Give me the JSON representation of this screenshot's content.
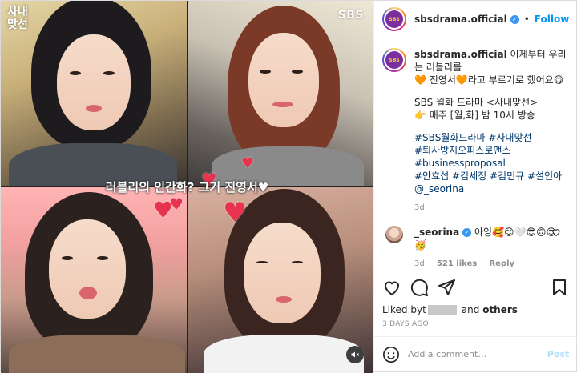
{
  "media": {
    "show_logo_line1": "사내",
    "show_logo_line2": "맞선",
    "broadcaster": "SBS",
    "overlay_caption": "러블리의 인간화? 그거 진영서♥",
    "mute_icon": "speaker-muted-icon"
  },
  "header": {
    "username": "sbsdrama.official",
    "verified_icon": "verified-badge-icon",
    "separator": "•",
    "follow_label": "Follow",
    "avatar_text": "SBS"
  },
  "caption": {
    "username": "sbsdrama.official",
    "line1": " 이제부터 우리는 러블리를",
    "line2": "🧡 진영서🧡라고 부르기로 했어요😋",
    "line3": "SBS 월화 드라마 <사내맞선>",
    "line4": "👉 매주 [월,화] 밤 10시 방송",
    "tags1": "#SBS월화드라마 #사내맞선",
    "tags2": "#퇴사방지오피스로맨스",
    "tags3": "#businessproposal",
    "tags4": "#안효섭 #김세정 #김민규 #설인아",
    "mention": "@_seorina",
    "age": "3d"
  },
  "comment": {
    "username": "_seorina",
    "text": " 아잉🥰😊🤍😎🙃😍",
    "text2": "🥳",
    "age": "3d",
    "likes": "521 likes",
    "reply_label": "Reply"
  },
  "likes": {
    "prefix": "Liked by ",
    "initial": "t",
    "connector": "and",
    "others": "others"
  },
  "timestamp": "3 DAYS AGO",
  "add_comment": {
    "placeholder": "Add a comment…",
    "post_label": "Post"
  },
  "colors": {
    "accent": "#0095f6",
    "verified": "#3897f0",
    "heart_overlay": "#e8334f"
  }
}
